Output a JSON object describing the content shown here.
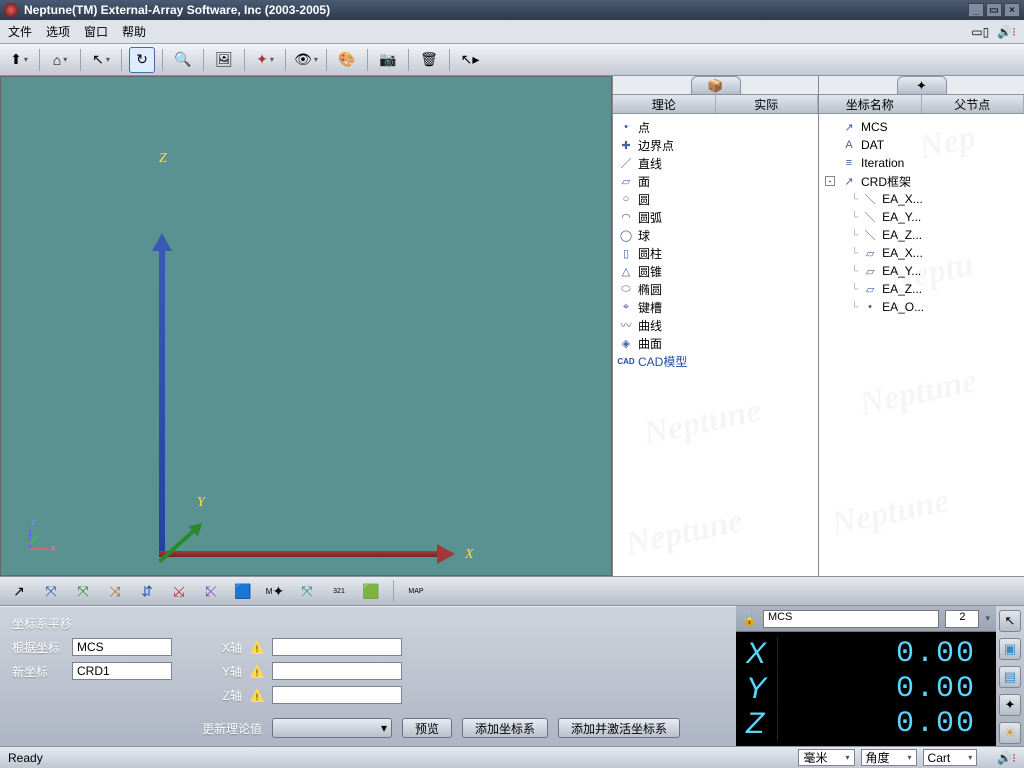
{
  "title": "Neptune(TM) External-Array Software, Inc (2003-2005)",
  "menus": [
    "文件",
    "选项",
    "窗口",
    "帮助"
  ],
  "axes": {
    "x": "X",
    "y": "Y",
    "z": "Z"
  },
  "panel1": {
    "headers": [
      "理论",
      "实际"
    ],
    "items": [
      {
        "icon": "•",
        "label": "点"
      },
      {
        "icon": "✚",
        "label": "边界点"
      },
      {
        "icon": "／",
        "label": "直线"
      },
      {
        "icon": "▱",
        "label": "面"
      },
      {
        "icon": "○",
        "label": "圆"
      },
      {
        "icon": "◠",
        "label": "圆弧"
      },
      {
        "icon": "◯",
        "label": "球"
      },
      {
        "icon": "▯",
        "label": "圆柱"
      },
      {
        "icon": "△",
        "label": "圆锥"
      },
      {
        "icon": "⬭",
        "label": "椭圆"
      },
      {
        "icon": "⌖",
        "label": "键槽"
      },
      {
        "icon": "〰",
        "label": "曲线"
      },
      {
        "icon": "◈",
        "label": "曲面"
      },
      {
        "icon": "CAD",
        "label": "CAD模型",
        "cad": true
      }
    ]
  },
  "panel2": {
    "headers": [
      "坐标名称",
      "父节点"
    ],
    "items": [
      {
        "icon": "↗",
        "label": "MCS"
      },
      {
        "icon": "A",
        "label": "DAT"
      },
      {
        "icon": "≡",
        "label": "Iteration"
      },
      {
        "icon": "↗",
        "label": "CRD框架",
        "exp": "-",
        "children": [
          {
            "icon": "＼",
            "label": "EA_X..."
          },
          {
            "icon": "＼",
            "label": "EA_Y..."
          },
          {
            "icon": "＼",
            "label": "EA_Z..."
          },
          {
            "icon": "▱",
            "label": "EA_X..."
          },
          {
            "icon": "▱",
            "label": "EA_Y..."
          },
          {
            "icon": "▱",
            "label": "EA_Z..."
          },
          {
            "icon": "•",
            "label": "EA_O..."
          }
        ]
      }
    ]
  },
  "form": {
    "title": "坐标系平移",
    "base_lbl": "根据坐标",
    "base_val": "MCS",
    "new_lbl": "新坐标",
    "new_val": "CRD1",
    "xlbl": "X轴",
    "ylbl": "Y轴",
    "zlbl": "Z轴",
    "update": "更新理论值",
    "preview": "预览",
    "add": "添加坐标系",
    "addact": "添加并激活坐标系"
  },
  "readout": {
    "cs": "MCS",
    "dec": "2",
    "lines": [
      {
        "a": "X",
        "v": "0.00"
      },
      {
        "a": "Y",
        "v": "0.00"
      },
      {
        "a": "Z",
        "v": "0.00"
      }
    ]
  },
  "status": {
    "ready": "Ready",
    "unit": "毫米",
    "angle": "角度",
    "cart": "Cart"
  }
}
